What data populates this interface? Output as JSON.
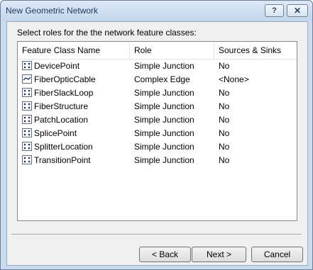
{
  "window": {
    "title": "New Geometric Network",
    "help_label": "?",
    "close_label": "✕"
  },
  "prompt": "Select roles for the the network feature classes:",
  "columns": [
    "Feature Class Name",
    "Role",
    "Sources & Sinks"
  ],
  "rows": [
    {
      "name": "DevicePoint",
      "role": "Simple Junction",
      "sources": "No",
      "icon": "junction-icon"
    },
    {
      "name": "FiberOpticCable",
      "role": "Complex Edge",
      "sources": "<None>",
      "icon": "edge-icon"
    },
    {
      "name": "FiberSlackLoop",
      "role": "Simple Junction",
      "sources": "No",
      "icon": "junction-icon"
    },
    {
      "name": "FiberStructure",
      "role": "Simple Junction",
      "sources": "No",
      "icon": "junction-icon"
    },
    {
      "name": "PatchLocation",
      "role": "Simple Junction",
      "sources": "No",
      "icon": "junction-icon"
    },
    {
      "name": "SplicePoint",
      "role": "Simple Junction",
      "sources": "No",
      "icon": "junction-icon"
    },
    {
      "name": "SplitterLocation",
      "role": "Simple Junction",
      "sources": "No",
      "icon": "junction-icon"
    },
    {
      "name": "TransitionPoint",
      "role": "Simple Junction",
      "sources": "No",
      "icon": "junction-icon"
    }
  ],
  "buttons": {
    "back": "< Back",
    "next": "Next >",
    "cancel": "Cancel"
  }
}
